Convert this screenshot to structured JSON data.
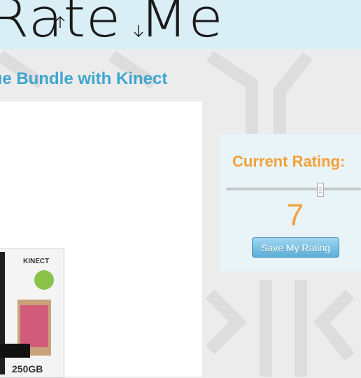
{
  "header": {
    "logo_text": "Rate Me",
    "logo_up_icon": "up-arrow-icon",
    "logo_down_icon": "down-arrow-icon",
    "background_color": "#d9eef5"
  },
  "product": {
    "title": "lue Bundle with Kinect",
    "image": {
      "brand_label": "KINECT",
      "badge": "250GB"
    }
  },
  "rating": {
    "heading": "Current Rating:",
    "value": "7",
    "slider_level": 0.7,
    "save_label": "Save My Rating"
  },
  "colors": {
    "accent_blue": "#3fa6cf",
    "accent_orange": "#f2a13b",
    "button_blue": "#5aaed8"
  }
}
